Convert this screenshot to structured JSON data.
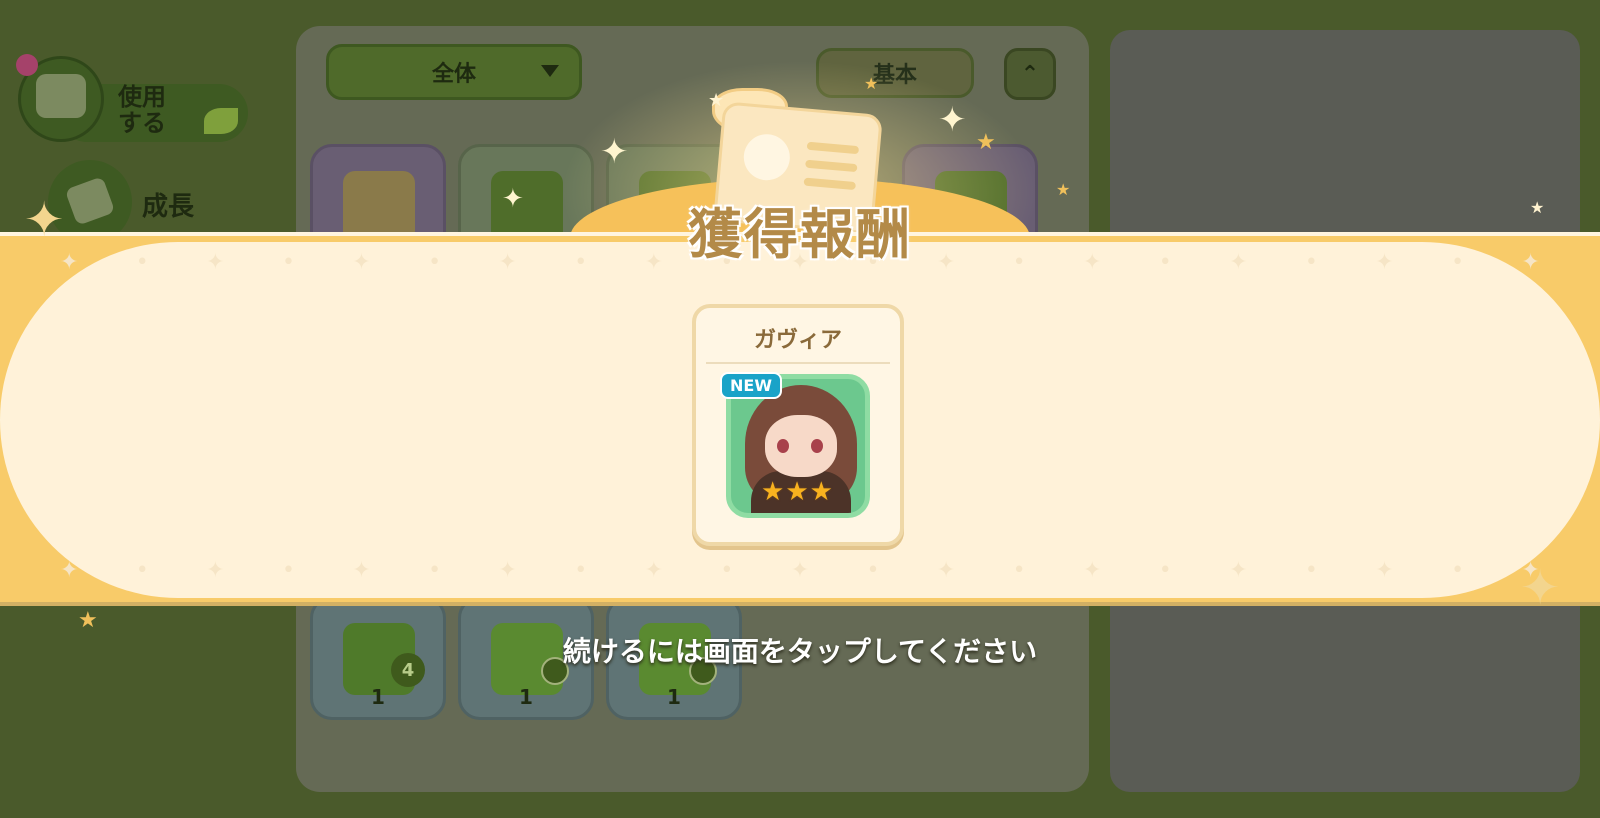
{
  "nav": {
    "use_label_line1": "使用",
    "use_label_line2": "する",
    "grow_label": "成長"
  },
  "inventory": {
    "filter_value": "全体",
    "sort_label": "基本",
    "collapse_glyph": "⌃",
    "items_bottom": [
      {
        "count": "1",
        "badge": "4"
      },
      {
        "count": "1"
      },
      {
        "count": "1"
      }
    ]
  },
  "reward": {
    "title": "獲得報酬",
    "character_name": "ガヴィア",
    "new_badge": "NEW",
    "rarity_stars": 3,
    "star_glyph": "★",
    "continue_hint": "続けるには画面をタップしてください"
  },
  "colors": {
    "band": "#fff2d9",
    "band_edge": "#f8cb69",
    "portrait_bg": "#6cc88e",
    "new_badge": "#1aa3c8"
  }
}
